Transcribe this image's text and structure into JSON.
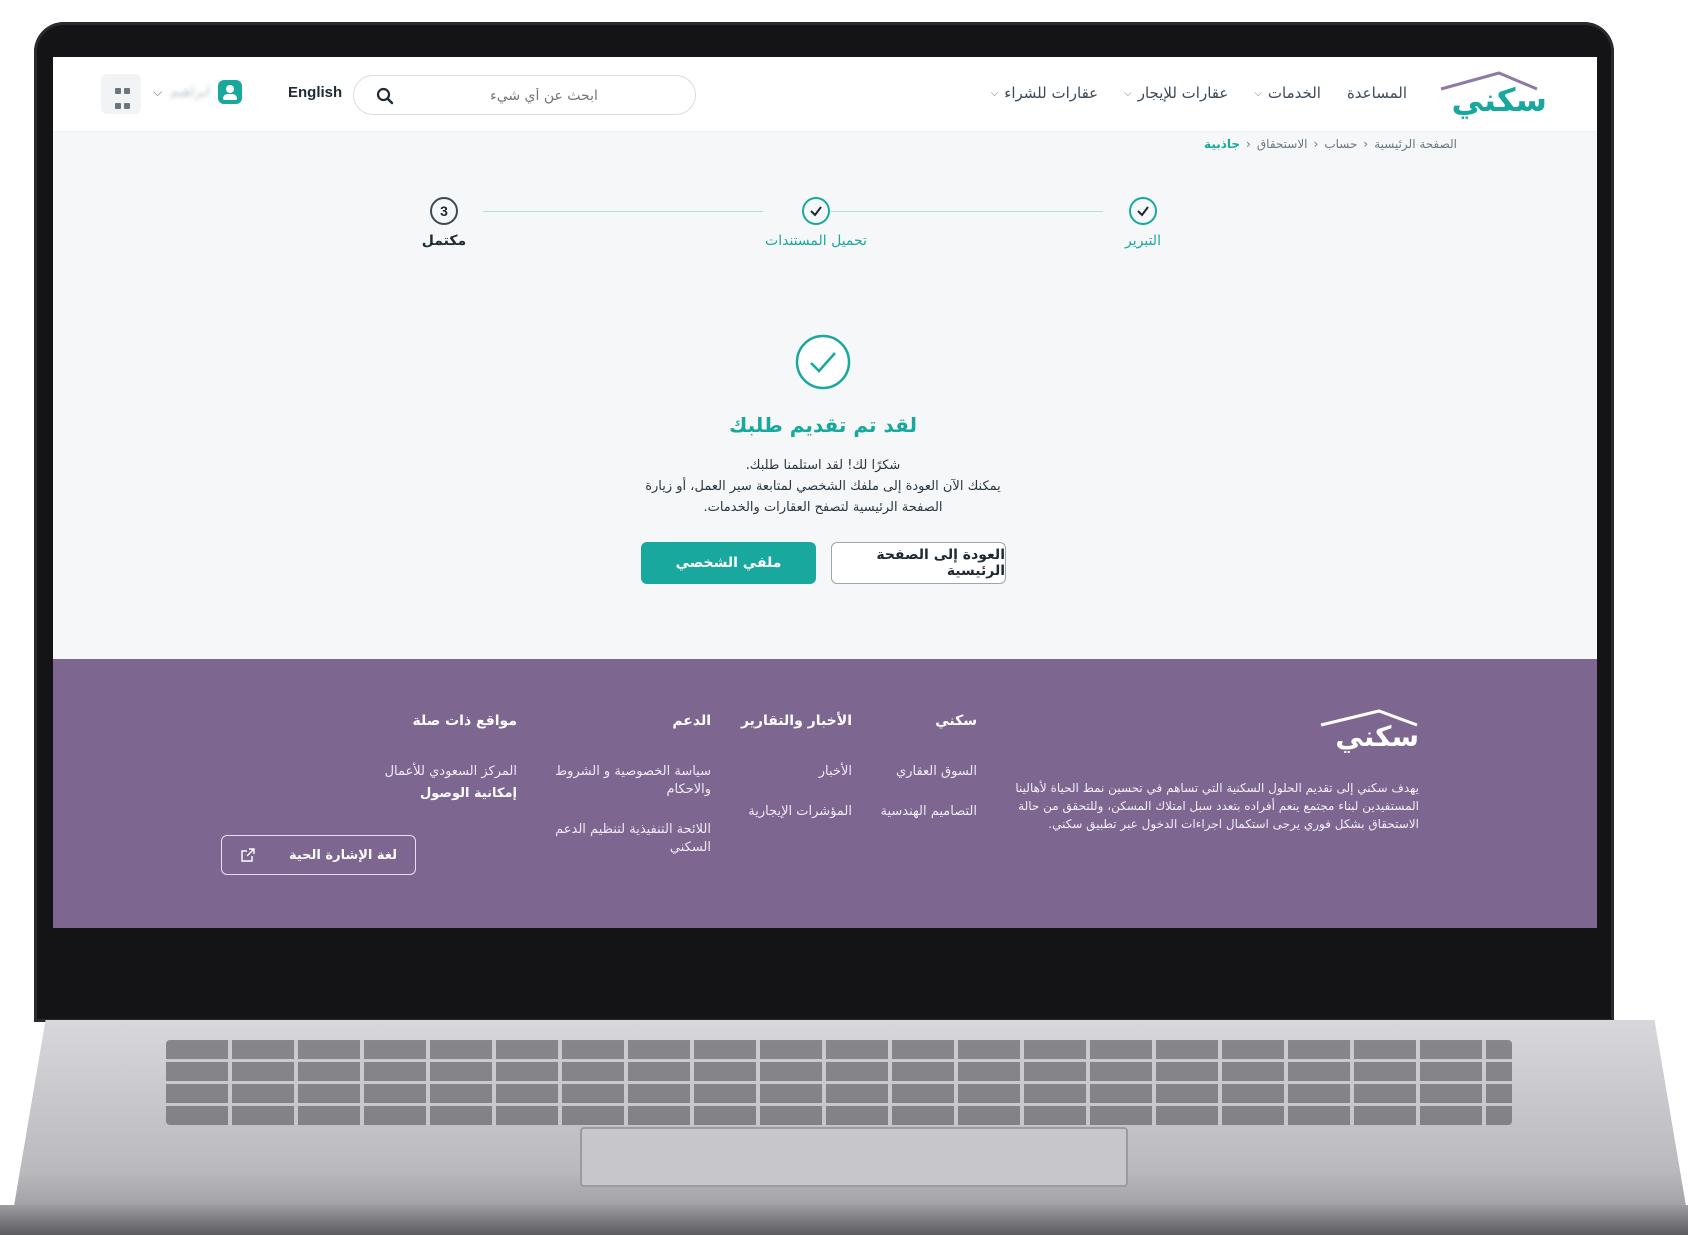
{
  "header": {
    "logo_text": "سكني",
    "nav": [
      {
        "label": "عقارات للشراء"
      },
      {
        "label": "عقارات للإيجار"
      },
      {
        "label": "الخدمات"
      },
      {
        "label": "المساعدة"
      }
    ],
    "search_placeholder": "ابحث عن أي شيء",
    "language": "English",
    "user_name": "ابراهيم"
  },
  "breadcrumb": [
    "الصفحة الرئيسية",
    "حساب",
    "الاستحقاق",
    "جاذبية"
  ],
  "stepper": {
    "steps": [
      {
        "label": "التبرير",
        "state": "done"
      },
      {
        "label": "تحميل المستندات",
        "state": "done"
      },
      {
        "label": "مكتمل",
        "state": "current",
        "number": "3"
      }
    ]
  },
  "success": {
    "title": "لقد تم تقديم طلبك",
    "line1": "شكرًا لك! لقد استلمنا طلبك.",
    "line2": "يمكنك الآن العودة إلى ملفك الشخصي لمتابعة سير العمل، أو زيارة الصفحة الرئيسية لتصفح العقارات والخدمات.",
    "primary_button": "ملفي الشخصي",
    "secondary_button": "العودة إلى الصفحة الرئيسية"
  },
  "footer": {
    "logo_text": "سكني",
    "description": "يهدف سكني إلى تقديم الحلول السكنية التي تساهم في تحسين نمط الحياة لأهالينا المستفيدين لبناء مجتمع ينعم أفراده بتعدد سبل امتلاك المسكن، وللتحقق من حالة الاستحقاق بشكل فوري يرجى استكمال اجراءات الدخول عبر تطبيق سكني.",
    "columns": [
      {
        "title": "سكني",
        "links": [
          "السوق العقاري",
          "التصاميم الهندسية"
        ]
      },
      {
        "title": "الأخبار والتقارير",
        "links": [
          "الأخبار",
          "المؤشرات الإيجارية"
        ]
      },
      {
        "title": "الدعم",
        "links": [
          "سياسة الخصوصية و الشروط والاحكام",
          "اللائحة التنفيذية لتنظيم الدعم السكني"
        ]
      },
      {
        "title": "مواقع ذات صلة",
        "links": [
          "المركز السعودي للأعمال"
        ],
        "bold_link": "إمكانية الوصول"
      }
    ],
    "sign_language_button": "لغة الإشارة الحية"
  },
  "colors": {
    "brand_teal": "#19a89d",
    "footer_purple": "#7d6690"
  }
}
